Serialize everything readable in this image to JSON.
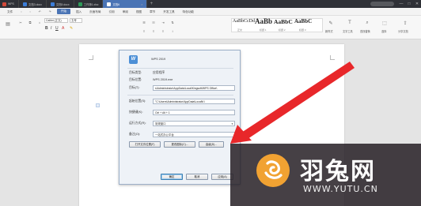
{
  "tabs": [
    {
      "label": "WPS",
      "color": "#d34a3b"
    },
    {
      "label": "文档3.docx",
      "color": "#3b7dd8"
    },
    {
      "label": "文档5.docx",
      "color": "#3b7dd8"
    },
    {
      "label": "工作簿1.xlsx",
      "color": "#2e9a58"
    },
    {
      "label": "文档6",
      "color": "#3b7dd8"
    }
  ],
  "window_controls": [
    "—",
    "□",
    "✕"
  ],
  "menu": {
    "file": "文件",
    "items": [
      "开始",
      "插入",
      "页面布局",
      "引用",
      "审阅",
      "视图",
      "章节",
      "开发工具",
      "特色功能"
    ],
    "active_index": 0
  },
  "toolbar": {
    "font_name": "Calibri (正文)",
    "font_size": "五号",
    "styles": [
      {
        "sample": "AaBbCcDd",
        "name": "正文"
      },
      {
        "sample": "AaBb",
        "name": "标题 1"
      },
      {
        "sample": "AaBbC",
        "name": "标题 2"
      },
      {
        "sample": "AaBbC",
        "name": "标题 3"
      }
    ],
    "right_buttons": [
      "新样式",
      "文字工具",
      "查找替换",
      "选择",
      "分享文档"
    ]
  },
  "dialog": {
    "app_name": "WPS 2019",
    "file_type_label": "目标类型:",
    "file_type_value": "应用程序",
    "location_label": "目标位置:",
    "location_value": "WPS 2019.exe",
    "target_label": "目标(T):",
    "target_value": "s\\Administrator\\AppData\\Local\\Kingsoft\\WPS Office\\",
    "start_in_label": "起始位置(S):",
    "start_in_value": "\"C:\\Users\\Administrator\\AppData\\Local\\Ki",
    "hotkey_label": "快捷键(K):",
    "hotkey_value": "Ctrl + Alt + 1",
    "run_label": "运行方式(R):",
    "run_value": "常规窗口",
    "comment_label": "备注(O):",
    "comment_value": "一站式办公平台",
    "buttons": {
      "open_location": "打开文件位置(F)",
      "change_icon": "更改图标(C)...",
      "advanced": "高级(D)...",
      "ok": "确定",
      "cancel": "取消",
      "apply": "应用(A)"
    }
  },
  "watermark": {
    "name": "羽兔网",
    "url": "WWW.YUTU.CN"
  },
  "colors": {
    "accent": "#4a74b5",
    "arrow": "#e8272a",
    "logo": "#f1a232"
  }
}
